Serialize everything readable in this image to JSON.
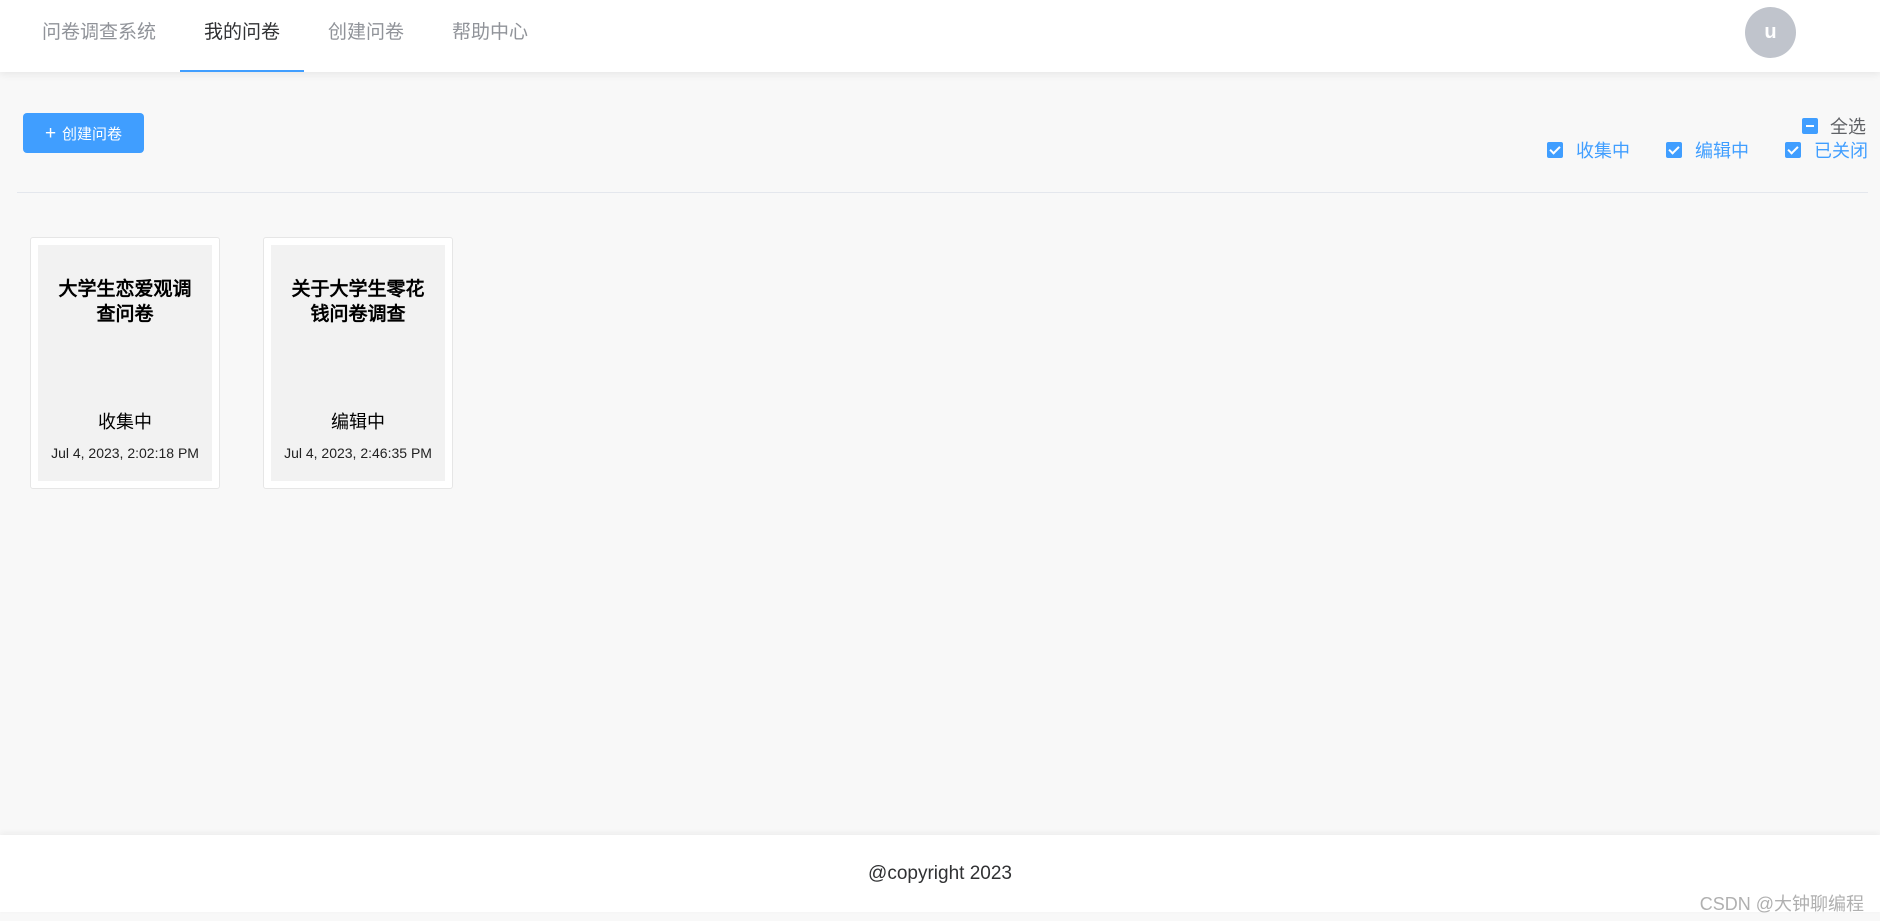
{
  "header": {
    "brand": "问卷调查系统",
    "nav": [
      {
        "label": "我的问卷",
        "active": true
      },
      {
        "label": "创建问卷",
        "active": false
      },
      {
        "label": "帮助中心",
        "active": false
      }
    ],
    "avatar_initial": "u"
  },
  "toolbar": {
    "create_icon": "plus-icon",
    "create_label": "创建问卷",
    "check_all_label": "全选",
    "filters": [
      "收集中",
      "编辑中",
      "已关闭"
    ]
  },
  "cards": [
    {
      "title": "大学生恋爱观调查问卷",
      "status": "收集中",
      "date": "Jul 4, 2023, 2:02:18 PM"
    },
    {
      "title": "关于大学生零花钱问卷调查",
      "status": "编辑中",
      "date": "Jul 4, 2023, 2:46:35 PM"
    }
  ],
  "footer": {
    "copyright": "@copyright 2023"
  },
  "watermark": "CSDN @大钟聊编程",
  "colors": {
    "primary": "#409eff",
    "avatar": "#c0c4cc",
    "background": "#f8f8f8"
  }
}
